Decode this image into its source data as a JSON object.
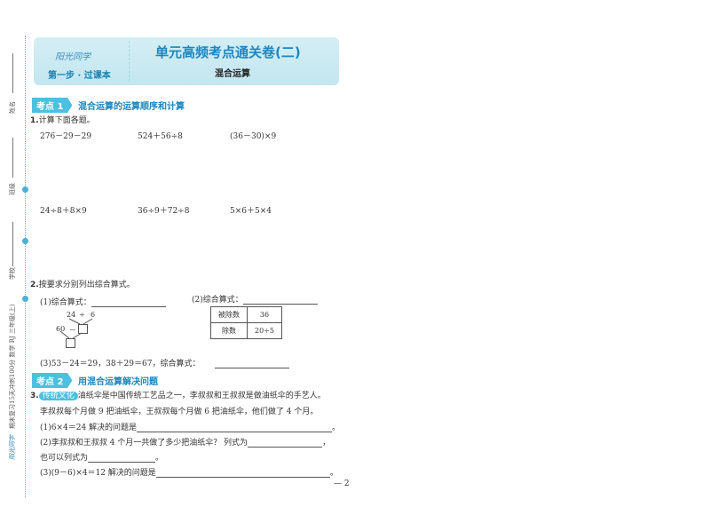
{
  "header": {
    "logo": "阳光同学",
    "step": "第一步 · 过课本",
    "title": "单元高频考点通关卷(二)",
    "subtitle": "混合运算"
  },
  "sidebar": {
    "name_label": "姓名",
    "class_label": "班级",
    "school_label": "学校",
    "book": "期末复习15天冲刺100分 数学 RJ 三年级(上)",
    "logo": "阳光同学"
  },
  "section1": {
    "tag": "考点 1",
    "title": "混合运算的运算顺序和计算"
  },
  "q1": {
    "num": "1.",
    "text": "计算下面各题。",
    "items": [
      "276－29－29",
      "524＋56÷8",
      "(36－30)×9",
      "24÷8＋8×9",
      "36÷9＋72÷8",
      "5×6＋5×4"
    ]
  },
  "q2": {
    "num": "2.",
    "text": "按要求分别列出综合算式。",
    "p1": "(1)综合算式：",
    "p2": "(2)综合算式：",
    "tree": {
      "a": "24",
      "op1": "÷",
      "b": "6",
      "c": "60",
      "op2": "－"
    },
    "table": [
      [
        "被除数",
        "36"
      ],
      [
        "除数",
        "20÷5"
      ]
    ],
    "p3": "(3)53－24＝29，38＋29＝67，综合算式："
  },
  "section2": {
    "tag": "考点 2",
    "title": "用混合运算解决问题"
  },
  "q3": {
    "num": "3.",
    "badge": "传统文化",
    "line1": "油纸伞是中国传统工艺品之一，李叔叔和王叔叔是做油纸伞的手艺人。",
    "line2": "李叔叔每个月做 9 把油纸伞，王叔叔每个月做 6 把油纸伞，他们做了 4 个月。",
    "s1": "(1)6×4＝24 解决的问题是",
    "s2": "(2)李叔叔和王叔叔 4 个月一共做了多少把油纸伞？ 列式为",
    "s2b": "也可以列式为",
    "s3": "(3)(9－6)×4＝12 解决的问题是",
    "end": "。",
    "comma": "，"
  },
  "page_number": "— 2"
}
